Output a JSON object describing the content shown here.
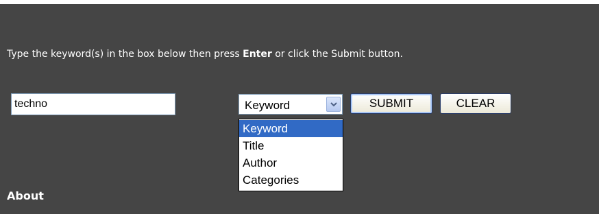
{
  "instructions": {
    "before": "Type the keyword(s) in the box below then press ",
    "emphasis": "Enter",
    "after": " or click the Submit button."
  },
  "search": {
    "value": "techno"
  },
  "search_type": {
    "selected": "Keyword",
    "options": [
      "Keyword",
      "Title",
      "Author",
      "Categories"
    ],
    "highlighted_option": "Keyword",
    "open": true
  },
  "buttons": {
    "submit_label": "SUBMIT",
    "clear_label": "CLEAR"
  },
  "sections": {
    "about_heading": "About"
  },
  "colors": {
    "panel_background": "#454545",
    "highlight": "#316ac5",
    "text_light": "#ffffff"
  },
  "icons": {
    "dropdown_arrow": "chevron-down-icon"
  }
}
